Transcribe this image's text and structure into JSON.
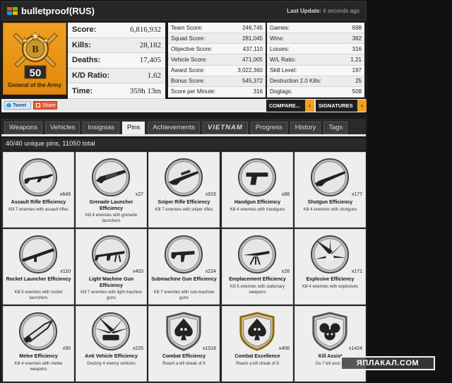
{
  "header": {
    "player": "bulletproof(RUS)",
    "update_label": "Last Update:",
    "update_value": "4 seconds ago"
  },
  "rank": {
    "number": "50",
    "name": "General of the Army"
  },
  "main_stats": [
    {
      "label": "Score:",
      "value": "6,816,932"
    },
    {
      "label": "Kills:",
      "value": "28,182"
    },
    {
      "label": "Deaths:",
      "value": "17,405"
    },
    {
      "label": "K/D Ratio:",
      "value": "1.62"
    },
    {
      "label": "Time:",
      "value": "359h 13m"
    }
  ],
  "stats_col1": [
    {
      "label": "Team Score:",
      "value": "246,745"
    },
    {
      "label": "Squad Score:",
      "value": "281,045"
    },
    {
      "label": "Objective Score:",
      "value": "437,110"
    },
    {
      "label": "Vehicle Score:",
      "value": "471,005"
    },
    {
      "label": "Award Score:",
      "value": "3,022,360"
    },
    {
      "label": "Bonus Score:",
      "value": "545,372"
    },
    {
      "label": "Score per Minute:",
      "value": "316"
    }
  ],
  "stats_col2": [
    {
      "label": "Games:",
      "value": "698"
    },
    {
      "label": "Wins:",
      "value": "382"
    },
    {
      "label": "Losses:",
      "value": "316"
    },
    {
      "label": "W/L Ratio:",
      "value": "1.21"
    },
    {
      "label": "Skill Level:",
      "value": "197"
    },
    {
      "label": "Destruction 2.0 Kills:",
      "value": "25"
    },
    {
      "label": "Dogtags:",
      "value": "508"
    }
  ],
  "actions": {
    "tweet": "Tweet",
    "share": "Share",
    "compare": "COMPARE...",
    "signatures": "SIGNATURES",
    "arrow": "›"
  },
  "tabs": [
    "Weapons",
    "Vehicles",
    "Insignias",
    "Pins",
    "Achievements",
    "VIETNAM",
    "Progress",
    "History",
    "Tags"
  ],
  "active_tab": "Pins",
  "summary": "40/40 unique pins, 11050 total",
  "pins": [
    {
      "title": "Assault Rifle Efficiency",
      "desc": "Kill 7 enemies with assault rifles",
      "count": "x649",
      "icon": "rifle-icon",
      "shape": "circle"
    },
    {
      "title": "Grenade Launcher Efficiency",
      "desc": "Kill 4 enemies with grenade launchers",
      "count": "x27",
      "icon": "grenade-launcher-icon",
      "shape": "circle"
    },
    {
      "title": "Sniper Rifle Efficiency",
      "desc": "Kill 7 enemies with sniper rifles",
      "count": "x915",
      "icon": "sniper-rifle-icon",
      "shape": "circle"
    },
    {
      "title": "Handgun Efficiency",
      "desc": "Kill 4 enemies with handguns",
      "count": "x88",
      "icon": "handgun-icon",
      "shape": "circle"
    },
    {
      "title": "Shotgun Efficiency",
      "desc": "Kill 4 enemies with shotguns",
      "count": "x177",
      "icon": "shotgun-icon",
      "shape": "circle"
    },
    {
      "title": "Rocket Launcher Efficiency",
      "desc": "Kill 5 enemies with rocket launchers",
      "count": "x110",
      "icon": "rocket-launcher-icon",
      "shape": "circle"
    },
    {
      "title": "Light Machine Gun Efficiency",
      "desc": "Kill 7 enemies with light machine guns",
      "count": "x403",
      "icon": "machine-gun-icon",
      "shape": "circle"
    },
    {
      "title": "Submachine Gun Efficiency",
      "desc": "Kill 7 enemies with sub-machine guns",
      "count": "x224",
      "icon": "submachine-gun-icon",
      "shape": "circle"
    },
    {
      "title": "Emplacement Efficiency",
      "desc": "Kill 5 enemies with stationary weapons",
      "count": "x28",
      "icon": "emplacement-gun-icon",
      "shape": "circle"
    },
    {
      "title": "Explosive Efficiency",
      "desc": "Kill 4 enemies with explosives",
      "count": "x171",
      "icon": "explosion-icon",
      "shape": "circle"
    },
    {
      "title": "Melee Efficiency",
      "desc": "Kill 4 enemies with melee weapons",
      "count": "x50",
      "icon": "knife-icon",
      "shape": "circle"
    },
    {
      "title": "Anti Vehicle Efficiency",
      "desc": "Destroy 4 enemy vehicles",
      "count": "x225",
      "icon": "tank-explosion-icon",
      "shape": "circle"
    },
    {
      "title": "Combat Efficiency",
      "desc": "Reach a kill streak of 6",
      "count": "x1018",
      "icon": "skull-spade-icon",
      "shape": "shield"
    },
    {
      "title": "Combat Excellence",
      "desc": "Reach a kill streak of 8",
      "count": "x406",
      "icon": "skull-spade-gold-icon",
      "shape": "shield-gold"
    },
    {
      "title": "Kill Assist",
      "desc": "Do 7 kill assists",
      "count": "x1424",
      "icon": "skulls-icon",
      "shape": "shield"
    }
  ],
  "watermark": "ЯПЛАКАЛ.COM"
}
